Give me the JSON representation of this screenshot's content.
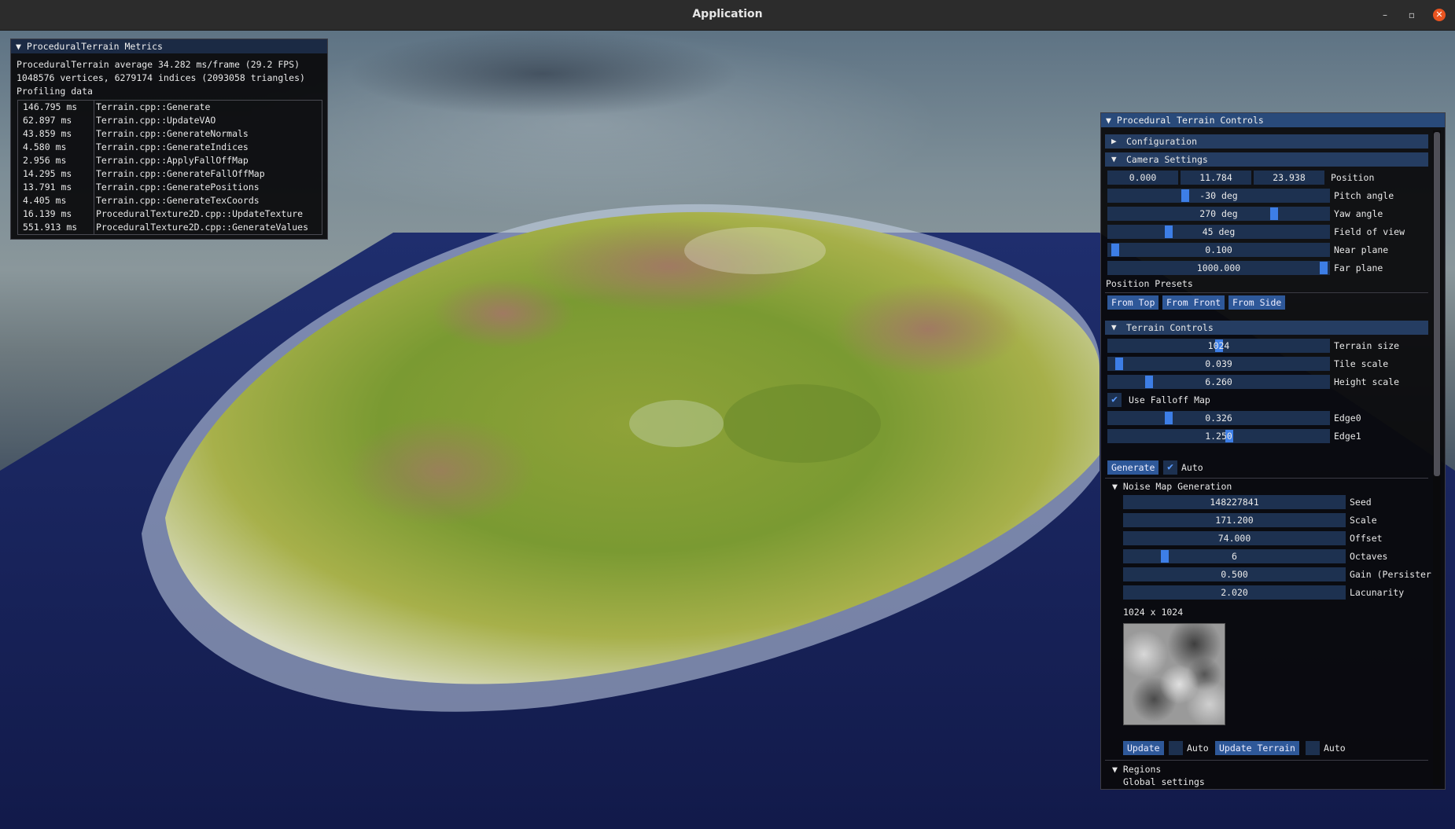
{
  "window": {
    "title": "Application",
    "minimize": "–",
    "maximize": "▫",
    "close": "✕"
  },
  "metrics": {
    "title": "ProceduralTerrain Metrics",
    "fps_line": "ProceduralTerrain average 34.282 ms/frame (29.2 FPS)",
    "geometry_line": "1048576 vertices, 6279174 indices (2093058 triangles)",
    "profiling_label": "Profiling data",
    "rows": [
      {
        "time": "146.795 ms",
        "name": "Terrain.cpp::Generate"
      },
      {
        "time": "62.897 ms",
        "name": "Terrain.cpp::UpdateVAO"
      },
      {
        "time": "43.859 ms",
        "name": "Terrain.cpp::GenerateNormals"
      },
      {
        "time": "4.580 ms",
        "name": "Terrain.cpp::GenerateIndices"
      },
      {
        "time": "2.956 ms",
        "name": "Terrain.cpp::ApplyFallOffMap"
      },
      {
        "time": "14.295 ms",
        "name": "Terrain.cpp::GenerateFallOffMap"
      },
      {
        "time": "13.791 ms",
        "name": "Terrain.cpp::GeneratePositions"
      },
      {
        "time": "4.405 ms",
        "name": "Terrain.cpp::GenerateTexCoords"
      },
      {
        "time": "16.139 ms",
        "name": "ProceduralTexture2D.cpp::UpdateTexture"
      },
      {
        "time": "551.913 ms",
        "name": "ProceduralTexture2D.cpp::GenerateValues"
      }
    ]
  },
  "controls": {
    "title": "Procedural Terrain Controls",
    "configuration": "Configuration",
    "camera": {
      "header": "Camera Settings",
      "position": [
        "0.000",
        "11.784",
        "23.938"
      ],
      "position_label": "Position",
      "pitch": {
        "value": "-30 deg",
        "label": "Pitch angle",
        "fraction": 0.42
      },
      "yaw": {
        "value": "270 deg",
        "label": "Yaw angle",
        "fraction": 0.75
      },
      "fov": {
        "value": "45 deg",
        "label": "Field of view",
        "fraction": 0.27
      },
      "near": {
        "value": "0.100",
        "label": "Near plane",
        "fraction": 0.0
      },
      "far": {
        "value": "1000.000",
        "label": "Far plane",
        "fraction": 1.0
      },
      "presets_label": "Position Presets",
      "presets": [
        "From Top",
        "From Front",
        "From Side"
      ]
    },
    "terrain": {
      "header": "Terrain Controls",
      "size": {
        "value": "1024",
        "label": "Terrain size",
        "fraction": 0.5
      },
      "tile_scale": {
        "value": "0.039",
        "label": "Tile scale",
        "fraction": 0.04
      },
      "height_scale": {
        "value": "6.260",
        "label": "Height scale",
        "fraction": 0.18
      },
      "use_falloff": "Use Falloff Map",
      "edge0": {
        "value": "0.326",
        "label": "Edge0",
        "fraction": 0.27
      },
      "edge1": {
        "value": "1.250",
        "label": "Edge1",
        "fraction": 0.55
      },
      "generate": "Generate",
      "auto": "Auto"
    },
    "noise": {
      "header": "Noise Map Generation",
      "seed": {
        "value": "148227841",
        "label": "Seed"
      },
      "scale": {
        "value": "171.200",
        "label": "Scale"
      },
      "offset": {
        "value": "74.000",
        "label": "Offset"
      },
      "octaves": {
        "value": "6",
        "label": "Octaves",
        "fraction": 0.17
      },
      "gain": {
        "value": "0.500",
        "label": "Gain (Persister"
      },
      "lacunarity": {
        "value": "2.020",
        "label": "Lacunarity"
      },
      "texture_size": "1024 x 1024",
      "update": "Update",
      "auto1": "Auto",
      "update_terrain": "Update Terrain",
      "auto2": "Auto"
    },
    "regions": {
      "header": "Regions",
      "global": "Global settings"
    }
  },
  "colors": {
    "accent": "#3d7ee6",
    "header": "#253d62",
    "frame": "#1d3150",
    "close": "#e95420"
  }
}
